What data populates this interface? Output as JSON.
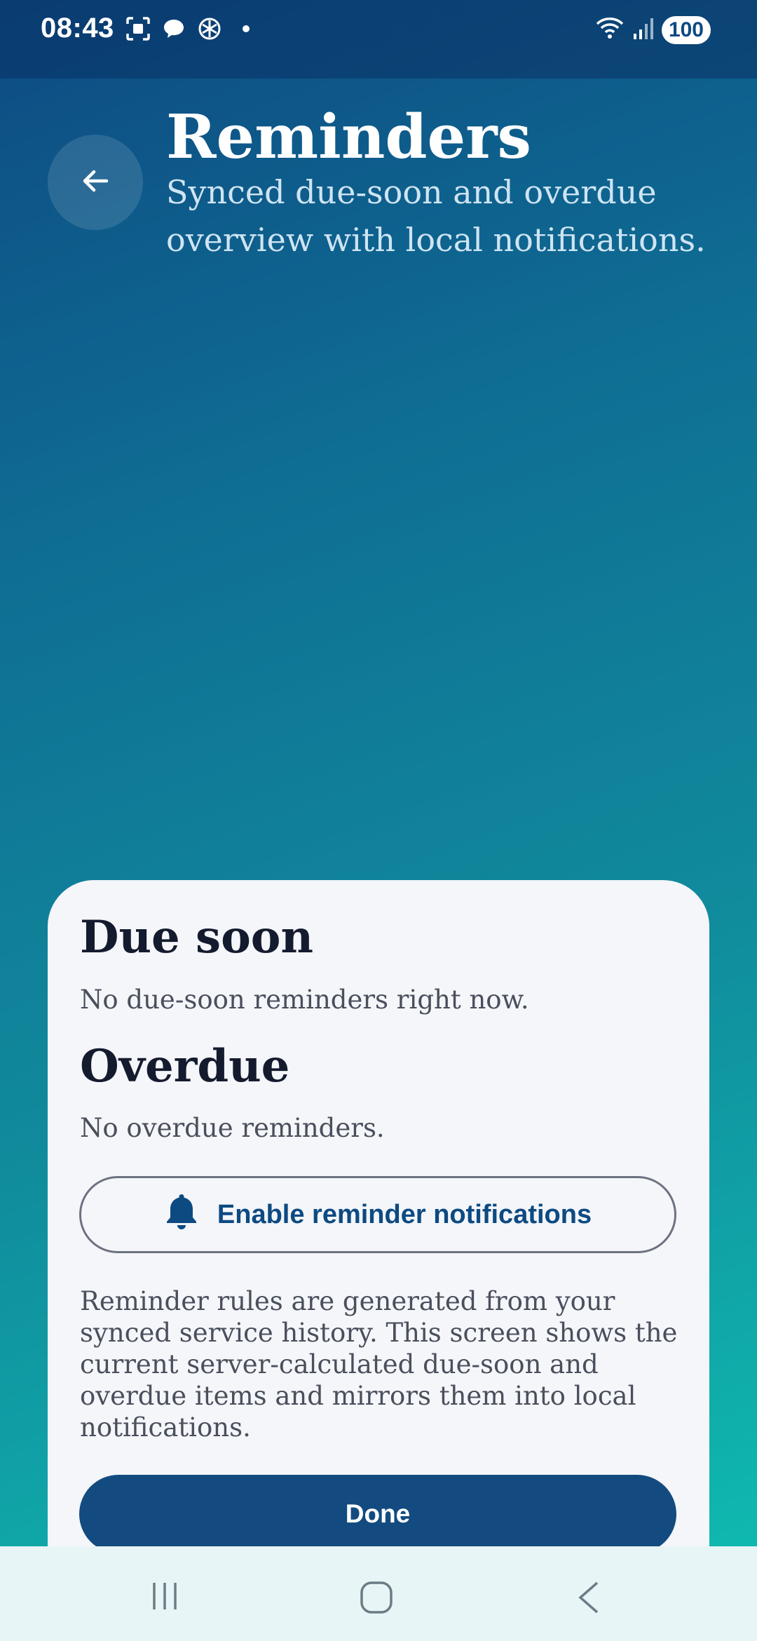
{
  "status_bar": {
    "time": "08:43",
    "battery": "100",
    "icons": [
      "screenshot-icon",
      "chat-icon",
      "ai-app-icon",
      "notification-dot",
      "wifi-icon",
      "signal-icon",
      "battery-icon"
    ]
  },
  "header": {
    "back_icon": "arrow-left-icon",
    "title": "Reminders",
    "subtitle": "Synced due-soon and overdue overview with local notifications."
  },
  "card": {
    "due_soon": {
      "title": "Due soon",
      "empty_text": "No due-soon reminders right now."
    },
    "overdue": {
      "title": "Overdue",
      "empty_text": "No overdue reminders."
    },
    "enable_button": {
      "icon": "bell-icon",
      "label": "Enable reminder notifications"
    },
    "explanation": "Reminder rules are generated from your synced service history. This screen shows the current server-calculated due-soon and overdue items and mirrors them into local notifications.",
    "done_label": "Done"
  },
  "nav": {
    "items": [
      "recent-apps-icon",
      "home-icon",
      "back-icon"
    ]
  },
  "colors": {
    "accent": "#0d4a82",
    "done_button": "#134b80",
    "card_background": "#f4f6fa",
    "gradient_top": "#0d4a82",
    "gradient_bottom": "#0fbfb2"
  }
}
